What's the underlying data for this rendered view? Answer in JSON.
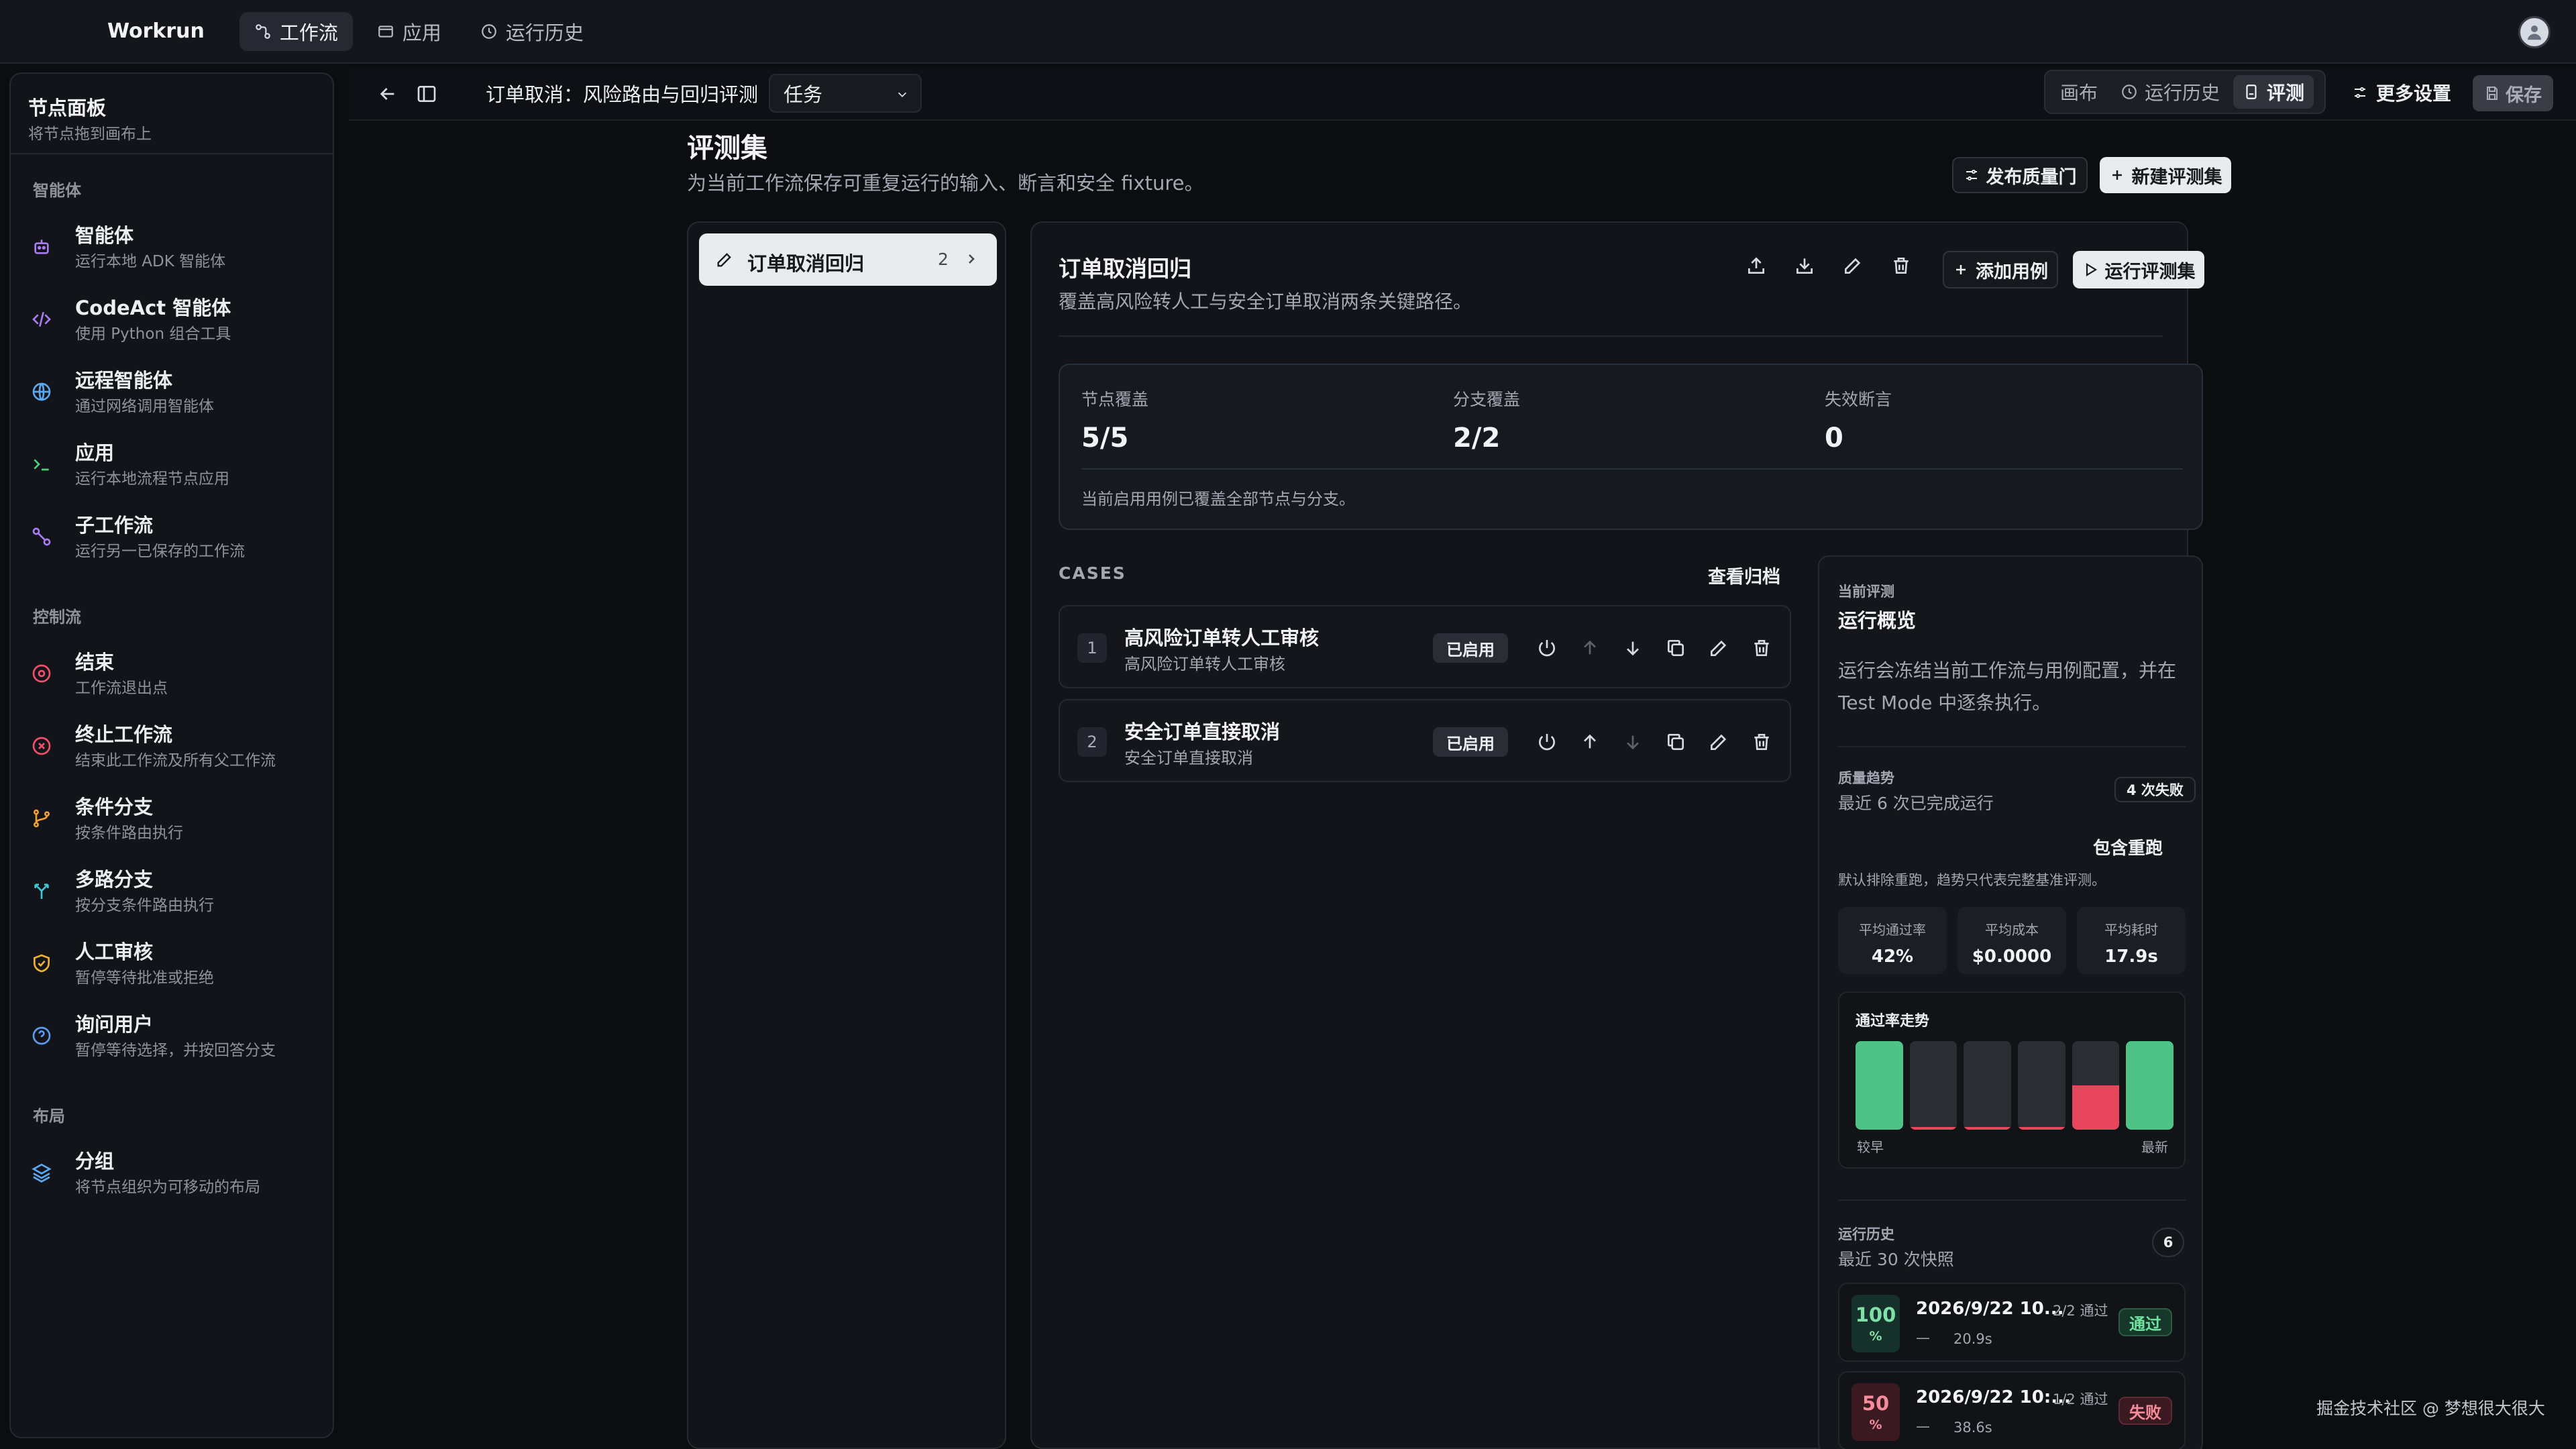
{
  "app": {
    "brand": "Workrun",
    "nav": [
      {
        "label": "工作流",
        "icon": "workflow-icon",
        "active": true
      },
      {
        "label": "应用",
        "icon": "app-icon",
        "active": false
      },
      {
        "label": "运行历史",
        "icon": "history-icon",
        "active": false
      }
    ]
  },
  "sidebar": {
    "title": "节点面板",
    "subtitle": "将节点拖到画布上",
    "sections": {
      "agents": "智能体",
      "control": "控制流",
      "layout": "布局"
    },
    "items": [
      {
        "name": "智能体",
        "desc": "运行本地 ADK 智能体",
        "icon": "robot-icon",
        "color": "#a87cf0"
      },
      {
        "name": "CodeAct 智能体",
        "desc": "使用 Python 组合工具",
        "icon": "code-icon",
        "color": "#a87cf0"
      },
      {
        "name": "远程智能体",
        "desc": "通过网络调用智能体",
        "icon": "globe-icon",
        "color": "#5aa9f0"
      },
      {
        "name": "应用",
        "desc": "运行本地流程节点应用",
        "icon": "terminal-icon",
        "color": "#4ccf7a"
      },
      {
        "name": "子工作流",
        "desc": "运行另一已保存的工作流",
        "icon": "subflow-icon",
        "color": "#a87cf0"
      },
      {
        "name": "结束",
        "desc": "工作流退出点",
        "icon": "stop-circle-icon",
        "color": "#f0506a"
      },
      {
        "name": "终止工作流",
        "desc": "结束此工作流及所有父工作流",
        "icon": "x-circle-icon",
        "color": "#f0506a"
      },
      {
        "name": "条件分支",
        "desc": "按条件路由执行",
        "icon": "branch-icon",
        "color": "#f0a030"
      },
      {
        "name": "多路分支",
        "desc": "按分支条件路由执行",
        "icon": "split-icon",
        "color": "#40c6d6"
      },
      {
        "name": "人工审核",
        "desc": "暂停等待批准或拒绝",
        "icon": "shield-check-icon",
        "color": "#f0b030"
      },
      {
        "name": "询问用户",
        "desc": "暂停等待选择，并按回答分支",
        "icon": "question-icon",
        "color": "#5a9cf0"
      },
      {
        "name": "分组",
        "desc": "将节点组织为可移动的布局",
        "icon": "layers-icon",
        "color": "#5aa9f0"
      }
    ]
  },
  "toolbar": {
    "workflow_title": "订单取消：风险路由与回归评测",
    "mode_select": "任务",
    "views": [
      {
        "label": "画布",
        "icon": "canvas-icon",
        "active": false
      },
      {
        "label": "运行历史",
        "icon": "history-icon",
        "active": false
      },
      {
        "label": "评测",
        "icon": "eval-icon",
        "active": true
      }
    ],
    "more_settings": "更多设置",
    "save": "保存"
  },
  "page": {
    "title": "评测集",
    "subtitle": "为当前工作流保存可重复运行的输入、断言和安全 fixture。",
    "publish_gate": "发布质量门",
    "new_set": "新建评测集"
  },
  "eval_sets": [
    {
      "name": "订单取消回归",
      "count": "2"
    }
  ],
  "detail": {
    "title": "订单取消回归",
    "subtitle": "覆盖高风险转人工与安全订单取消两条关键路径。",
    "add_case": "添加用例",
    "run_set": "运行评测集",
    "coverage": {
      "node_label": "节点覆盖",
      "node_value": "5/5",
      "branch_label": "分支覆盖",
      "branch_value": "2/2",
      "fail_label": "失效断言",
      "fail_value": "0",
      "note": "当前启用用例已覆盖全部节点与分支。"
    },
    "cases_label": "CASES",
    "view_archive": "查看归档",
    "cases": [
      {
        "num": "1",
        "name": "高风险订单转人工审核",
        "desc": "高风险订单转人工审核",
        "status": "已启用"
      },
      {
        "num": "2",
        "name": "安全订单直接取消",
        "desc": "安全订单直接取消",
        "status": "已启用"
      }
    ]
  },
  "overview": {
    "kicker": "当前评测",
    "title": "运行概览",
    "desc": "运行会冻结当前工作流与用例配置，并在 Test Mode 中逐条执行。",
    "quality_kicker": "质量趋势",
    "quality_sub": "最近 6 次已完成运行",
    "fail_pill": "4 次失败",
    "include_rerun": "包含重跑",
    "rerun_note": "默认排除重跑，趋势只代表完整基准评测。",
    "metrics": [
      {
        "label": "平均通过率",
        "value": "42%"
      },
      {
        "label": "平均成本",
        "value": "$0.0000"
      },
      {
        "label": "平均耗时",
        "value": "17.9s"
      }
    ],
    "trend_title": "通过率走势",
    "trend_low": "较早",
    "trend_high": "最新",
    "trend_values": [
      100,
      0,
      0,
      0,
      50,
      100
    ],
    "pass_color": "#4fc287",
    "fail_color": "#e8465c",
    "history_kicker": "运行历史",
    "history_sub": "最近 30 次快照",
    "history_count": "6",
    "runs": [
      {
        "pct": "100",
        "unit": "%",
        "when": "2026/9/22 10...",
        "ratio": "2/2 通过",
        "dash": "—",
        "dur": "20.9s",
        "status": "通过",
        "pass": true
      },
      {
        "pct": "50",
        "unit": "%",
        "when": "2026/9/22 10:...",
        "ratio": "1/2 通过",
        "dash": "—",
        "dur": "38.6s",
        "status": "失败",
        "pass": false
      }
    ]
  },
  "watermark": "掘金技术社区 @ 梦想很大很大"
}
